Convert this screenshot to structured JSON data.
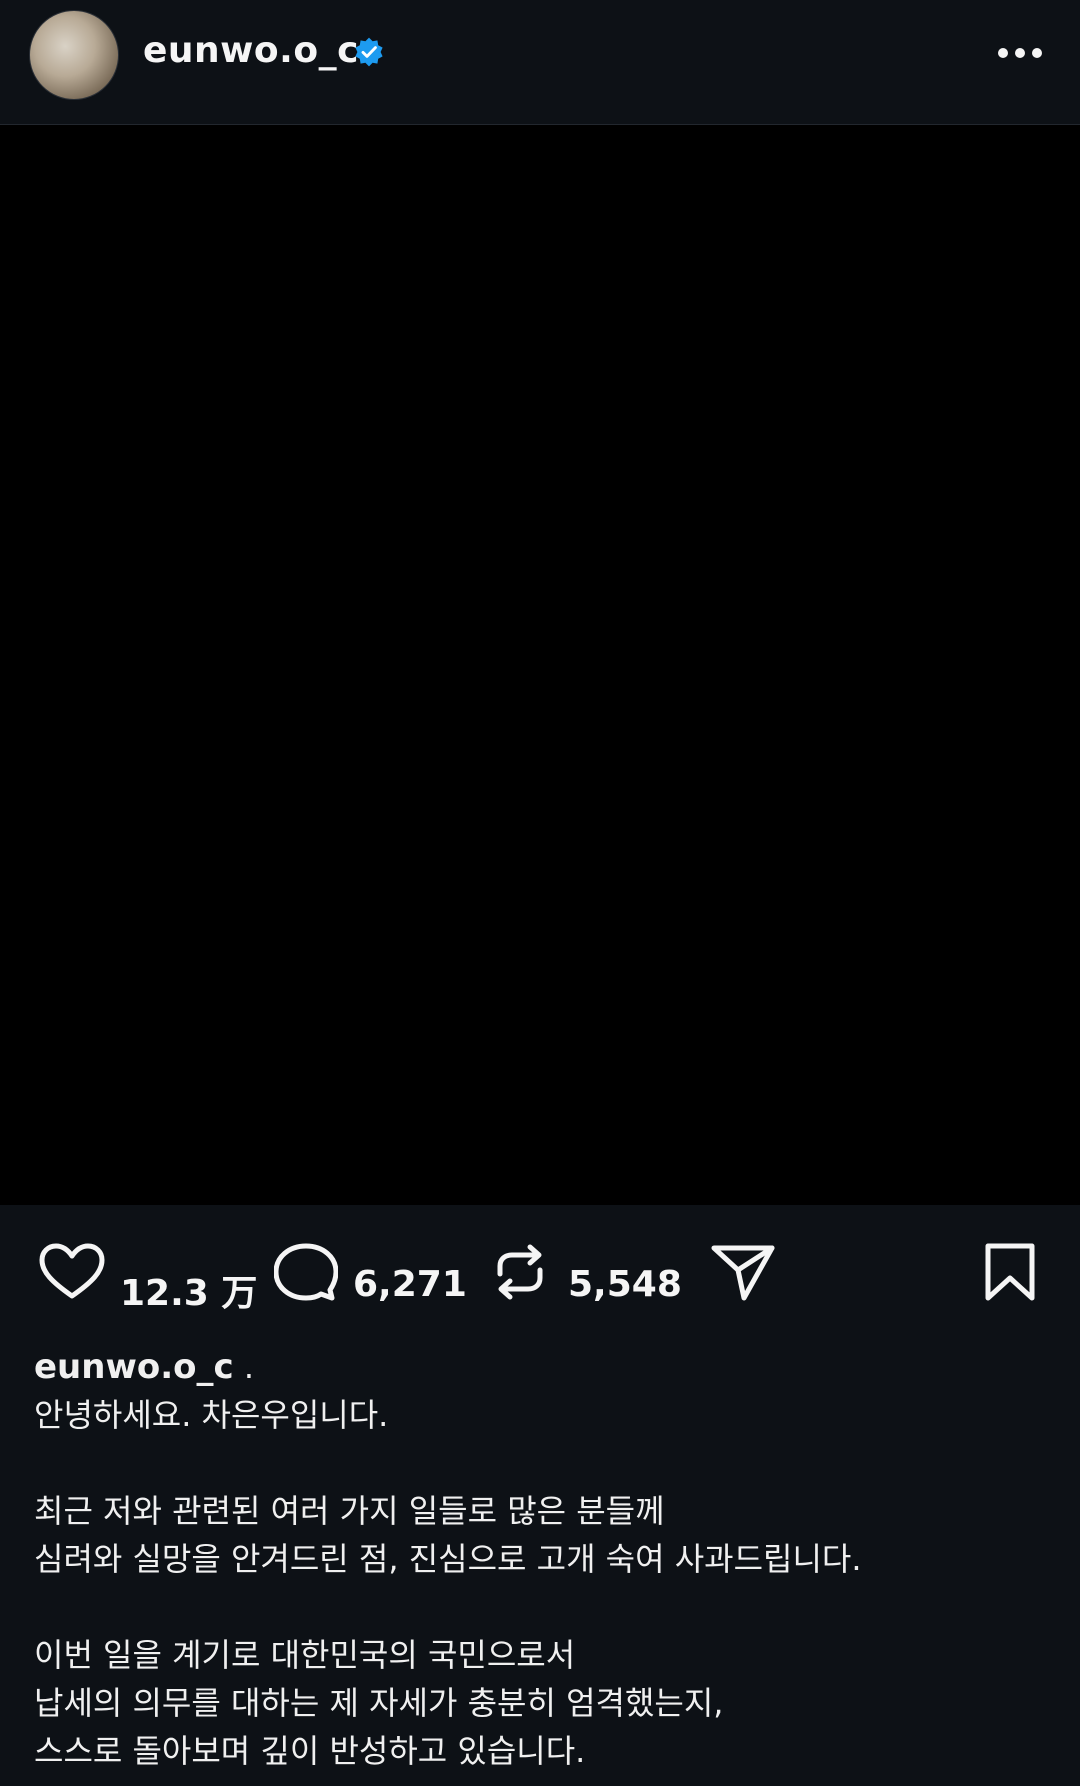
{
  "header": {
    "username": "eunwo.o_c"
  },
  "actions": {
    "likes": "12.3 万",
    "comments": "6,271",
    "reposts": "5,548"
  },
  "caption": {
    "username": "eunwo.o_c",
    "suffix": ".",
    "lines": [
      "안녕하세요. 차은우입니다.",
      "",
      "최근 저와 관련된 여러 가지 일들로 많은 분들께",
      "심려와 실망을 안겨드린 점, 진심으로 고개 숙여 사과드립니다.",
      "",
      "이번 일을 계기로 대한민국의 국민으로서",
      "납세의 의무를 대하는 제 자세가 충분히 엄격했는지,",
      "스스로 돌아보며 깊이 반성하고 있습니다."
    ]
  },
  "colors": {
    "background": "#0d1116",
    "media": "#000000",
    "verified": "#1d9bf0",
    "text": "#f5f5f5"
  },
  "icons": [
    "verified-badge-icon",
    "more-icon",
    "heart-icon",
    "comment-icon",
    "repost-icon",
    "share-icon",
    "bookmark-icon"
  ]
}
